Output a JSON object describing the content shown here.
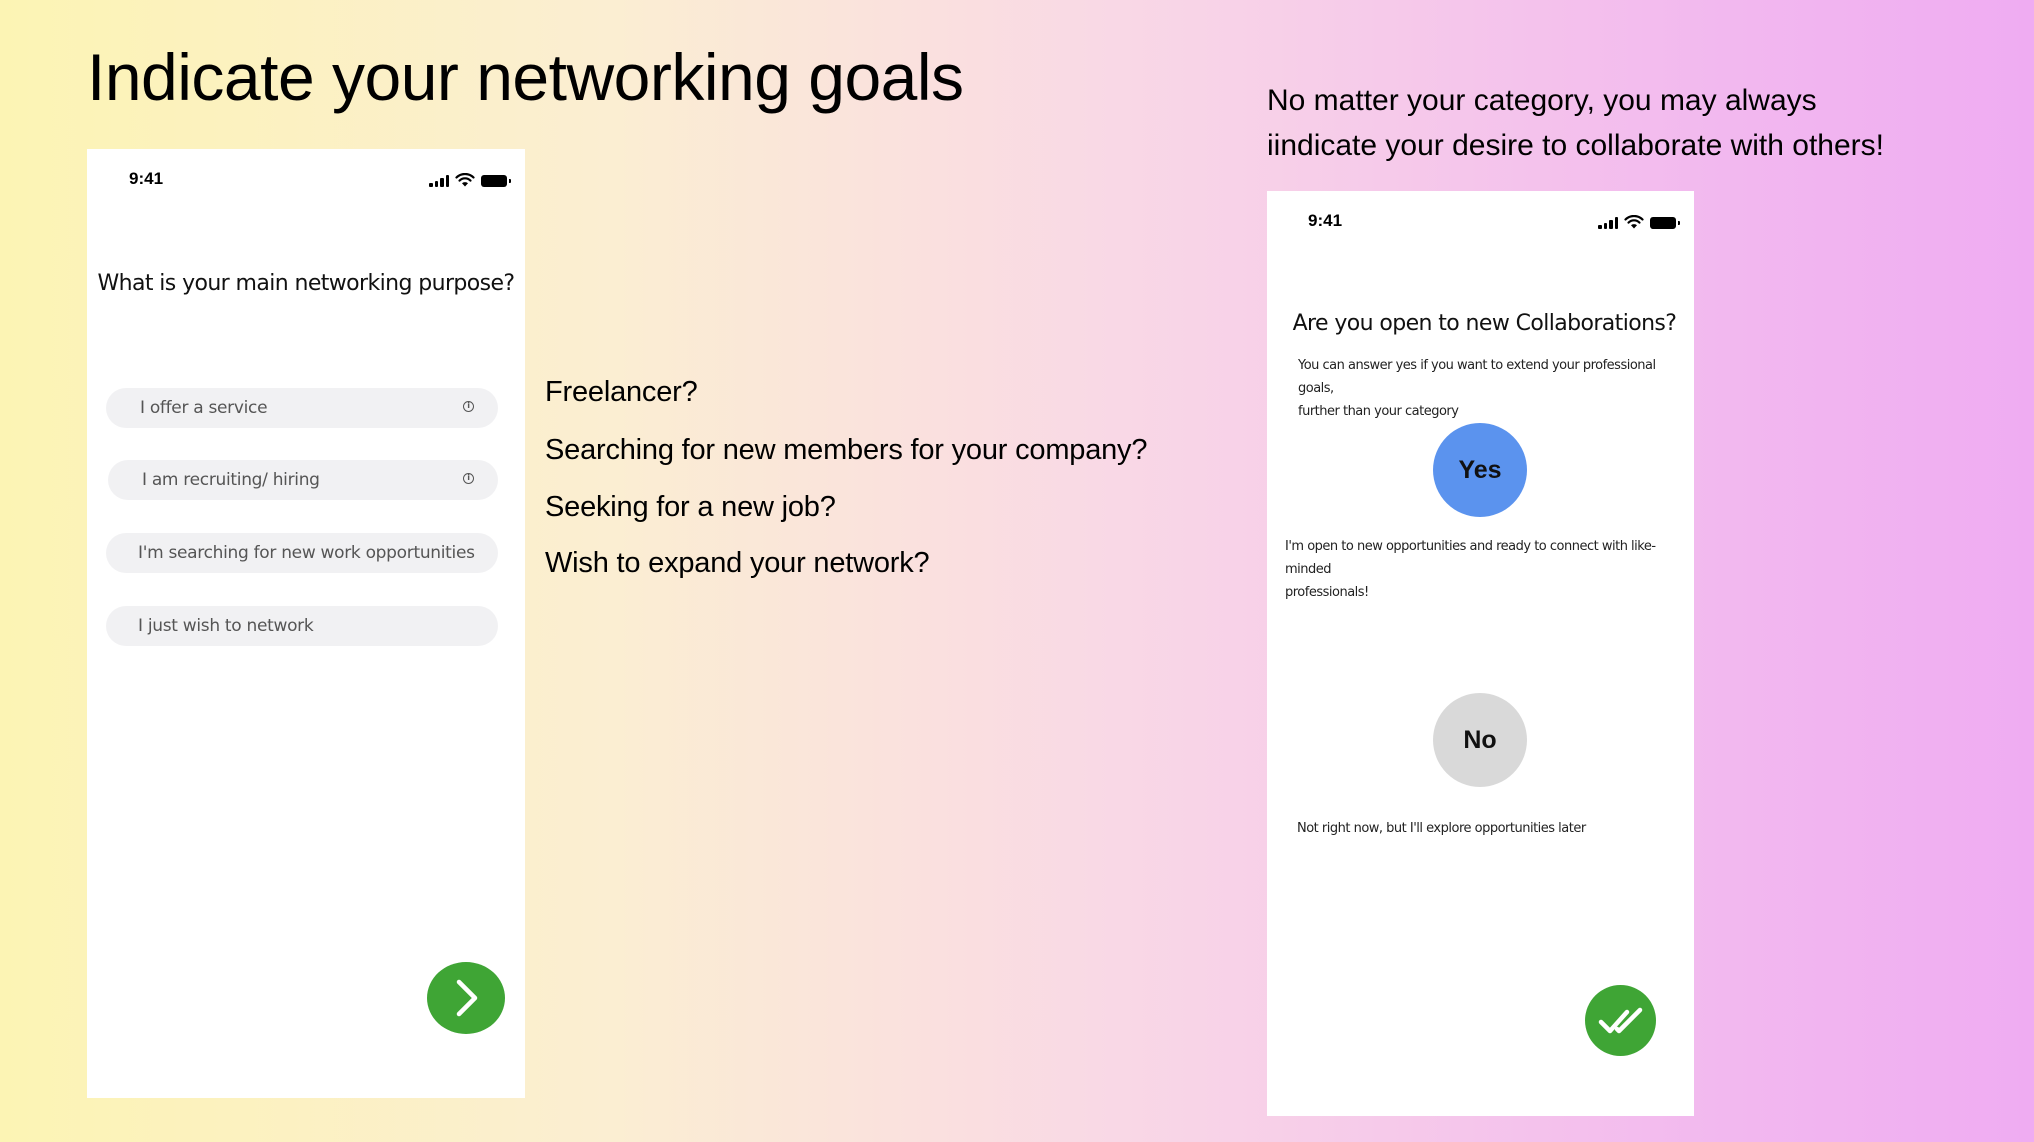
{
  "slide": {
    "title": "Indicate your networking goals",
    "right_caption_line1": "No matter your category, you may always",
    "right_caption_line2": "iindicate your desire to collaborate with others!"
  },
  "left_phone": {
    "status_time": "9:41",
    "question": "What is your main networking purpose?",
    "options": [
      {
        "label": "I offer a service",
        "has_info": true
      },
      {
        "label": "I am recruiting/ hiring",
        "has_info": true
      },
      {
        "label": "I'm searching for new work opportunities",
        "has_info": false
      },
      {
        "label": "I just wish to network",
        "has_info": false
      }
    ],
    "info_symbol": "i",
    "next_button_icon": "chevron-right-icon"
  },
  "middle_text": {
    "items": [
      "Freelancer?",
      "Searching for new members for your company?",
      "Seeking for a new job?",
      "Wish to expand your network?"
    ]
  },
  "right_phone": {
    "status_time": "9:41",
    "question": "Are you open to new Collaborations?",
    "hint_line1": "You can answer yes if you want to extend your professional goals,",
    "hint_line2": "further than your category",
    "yes_label": "Yes",
    "yes_desc_line1": "I'm open to new opportunities and ready to connect with like-minded",
    "yes_desc_line2": "professionals!",
    "no_label": "No",
    "no_desc": "Not right now, but I'll explore opportunities later",
    "confirm_button_icon": "double-check-icon"
  },
  "colors": {
    "accent_green": "#3fa535",
    "yes_blue": "#5b93ee",
    "no_gray": "#d9d9d9",
    "pill_gray": "#f1f1f3"
  }
}
